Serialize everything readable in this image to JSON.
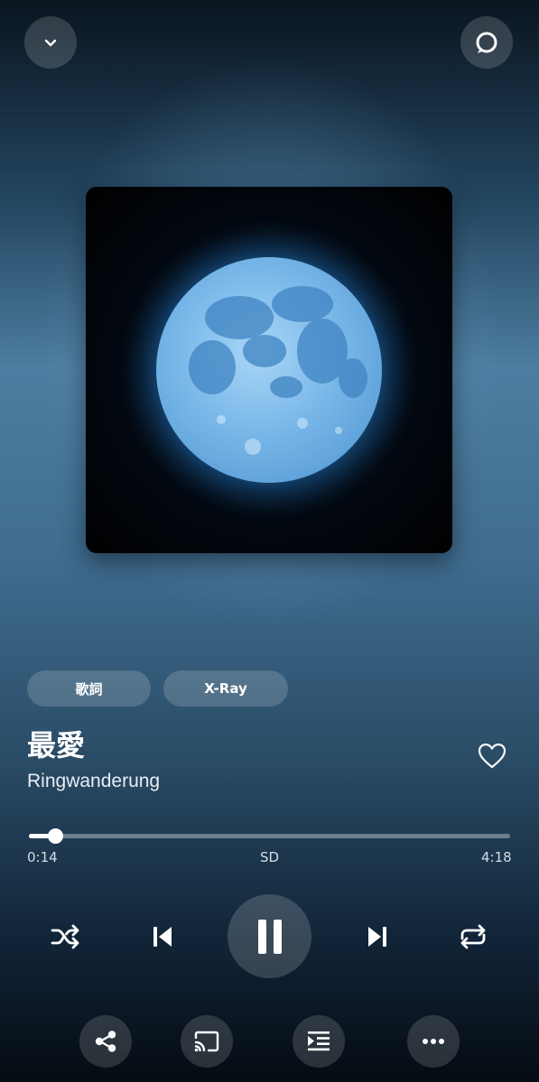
{
  "header": {
    "collapse_icon": "chevron-down-icon",
    "alexa_icon": "alexa-ring-icon"
  },
  "album_art": {
    "subject": "full-moon",
    "colors": {
      "moon": "#8ec3ee",
      "glow": "#2f7fc4",
      "background": "#000000"
    }
  },
  "chips": [
    {
      "label": "歌詞"
    },
    {
      "label": "X-Ray"
    }
  ],
  "track": {
    "title": "最愛",
    "artist": "Ringwanderung",
    "favorite_icon": "heart-outline-icon"
  },
  "progress": {
    "elapsed": "0:14",
    "quality": "SD",
    "duration": "4:18",
    "fraction": 0.054
  },
  "controls": {
    "shuffle_icon": "shuffle-icon",
    "previous_icon": "skip-previous-icon",
    "pause_icon": "pause-icon",
    "next_icon": "skip-next-icon",
    "repeat_icon": "repeat-icon"
  },
  "bottom_bar": {
    "share_icon": "share-icon",
    "cast_icon": "cast-icon",
    "queue_icon": "queue-icon",
    "more_icon": "more-horizontal-icon"
  }
}
